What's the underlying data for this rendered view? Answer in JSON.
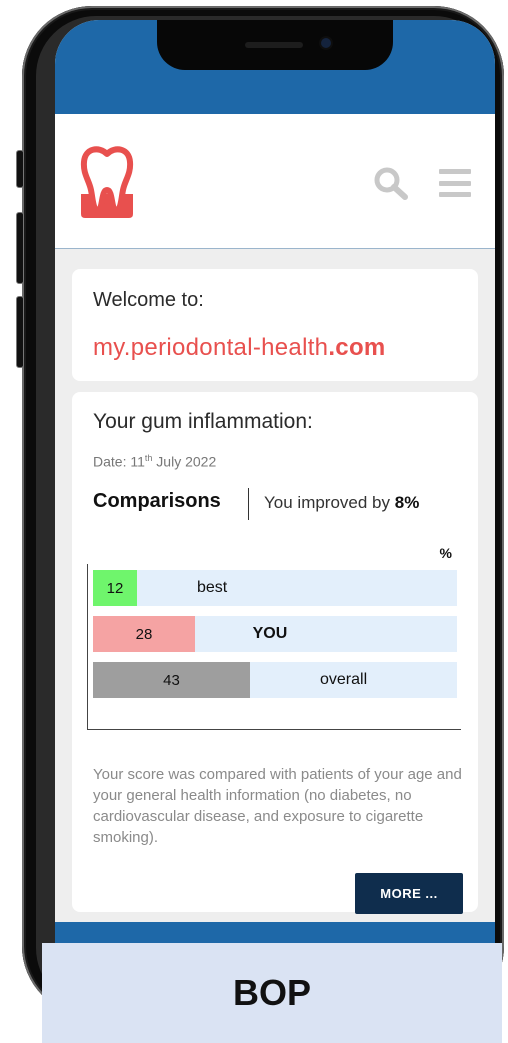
{
  "welcome_card": {
    "welcome_text": "Welcome to:",
    "site_prefix": "my.periodontal-health",
    "site_suffix": ".com"
  },
  "results_card": {
    "title": "Your gum inflammation:",
    "date_prefix": "Date: 11",
    "date_sup": "th",
    "date_suffix": " July 2022",
    "comparisons_label": "Comparisons",
    "improved_text": "You improved by ",
    "improved_value": "8%",
    "unit_label": "%",
    "description": "Your score was compared with patients of your age and your general health information (no diabetes, no cardiovascular disease, and exposure to cigarette smoking).",
    "more_button": "MORE ..."
  },
  "chart_data": {
    "type": "bar",
    "categories": [
      "best",
      "YOU",
      "overall"
    ],
    "values": [
      12,
      28,
      43
    ],
    "colors": [
      "#6ff56c",
      "#f5a3a3",
      "#9e9e9e"
    ],
    "track_color": "#e3effb",
    "xlim": [
      0,
      100
    ],
    "ylabel": "%"
  },
  "footer_label": "BOP",
  "colors": {
    "brand_blue": "#1e68a8",
    "accent_red": "#e8504e",
    "button_navy": "#0f2d4d"
  },
  "icons": [
    "tooth-logo-icon",
    "search-icon",
    "menu-icon"
  ]
}
